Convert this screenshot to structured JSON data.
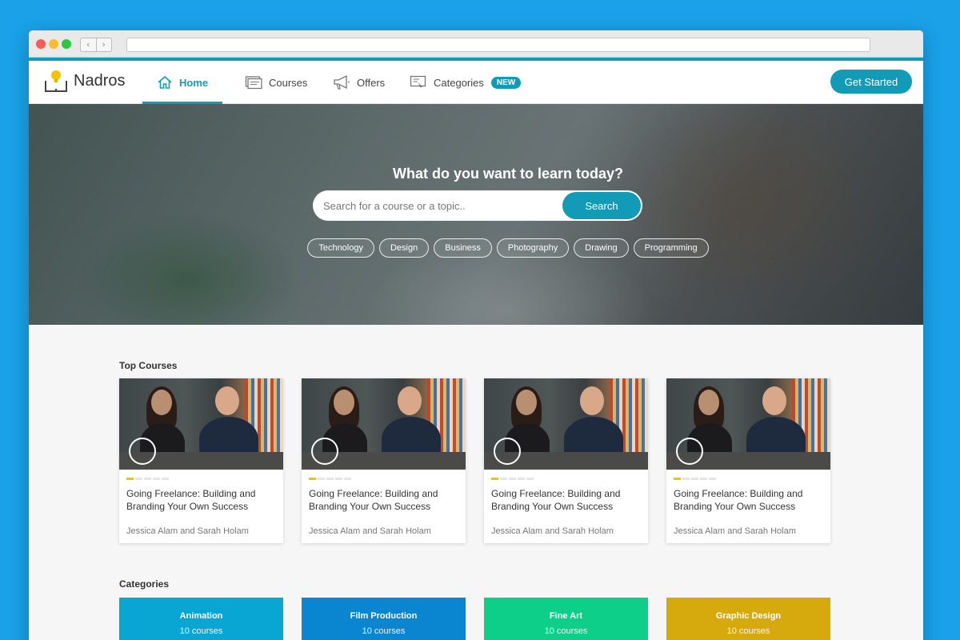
{
  "brand": {
    "name": "Nadros"
  },
  "nav": {
    "items": [
      {
        "label": "Home",
        "icon": "home-icon",
        "active": true
      },
      {
        "label": "Courses",
        "icon": "courses-icon"
      },
      {
        "label": "Offers",
        "icon": "megaphone-icon"
      },
      {
        "label": "Categories",
        "icon": "categories-icon",
        "badge": "NEW"
      }
    ],
    "cta": "Get Started"
  },
  "hero": {
    "title": "What do you want to learn today?",
    "search": {
      "placeholder": "Search for a course or a topic..",
      "button": "Search"
    },
    "tags": [
      "Technology",
      "Design",
      "Business",
      "Photography",
      "Drawing",
      "Programming"
    ]
  },
  "top_courses": {
    "title": "Top Courses",
    "courses": [
      {
        "title": "Going Freelance: Building and Branding Your Own Success",
        "authors": "Jessica Alam and Sarah Holam",
        "progress": 0.2
      },
      {
        "title": "Going Freelance: Building and Branding Your Own Success",
        "authors": "Jessica Alam and Sarah Holam",
        "progress": 0.2
      },
      {
        "title": "Going Freelance: Building and Branding Your Own Success",
        "authors": "Jessica Alam and Sarah Holam",
        "progress": 0.2
      },
      {
        "title": "Going Freelance: Building and Branding Your Own Success",
        "authors": "Jessica Alam and Sarah Holam",
        "progress": 0.2
      }
    ]
  },
  "categories": {
    "title": "Categories",
    "items": [
      {
        "name": "Animation",
        "count": "10 courses",
        "color": "#0aa6d3"
      },
      {
        "name": "Film Production",
        "count": "10 courses",
        "color": "#0a85d0"
      },
      {
        "name": "Fine Art",
        "count": "10 courses",
        "color": "#0ecf8a"
      },
      {
        "name": "Graphic Design",
        "count": "10 courses",
        "color": "#d6a90c"
      }
    ]
  },
  "colors": {
    "accent": "#119bb7",
    "background": "#1aa1e8",
    "progress": "#f2c400"
  }
}
